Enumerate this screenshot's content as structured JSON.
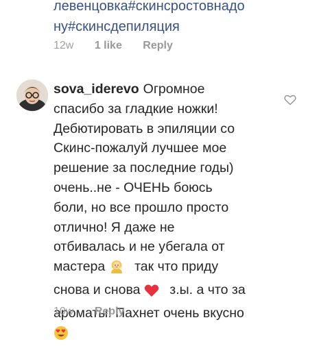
{
  "hashtags": {
    "line1": "левенцовка#скинсростовнадо",
    "line2": "ну#скинсдепиляция"
  },
  "previous_comment": {
    "time": "12w",
    "likes": "1 like",
    "reply_label": "Reply"
  },
  "comment": {
    "username": "sova_iderevo",
    "lines": [
      "Огромное",
      "спасибо за гладкие ножки!",
      "Дебютировать в эпиляции со",
      "Скинс-пожалуй лучшее мое",
      "решение за последние годы)",
      "очень..не - ОЧЕНЬ боюсь",
      "боли, но все прошло просто",
      "отлично! Я даже не",
      "отбивалась и не убегала от",
      "мастера",
      "так что приду",
      "снова и снова",
      "з.ы. а что за",
      "ароматы! Пахнет очень вкусно"
    ],
    "time": "10w",
    "reply_label": "Reply",
    "emojis": [
      "person-emoji",
      "red-heart-emoji",
      "heart-eyes-emoji"
    ]
  },
  "icons": {
    "like": "heart-outline-icon"
  },
  "colors": {
    "hashtag": "#385185",
    "text": "#262626",
    "meta": "#a0a0a0",
    "heart": "#e8303f"
  }
}
